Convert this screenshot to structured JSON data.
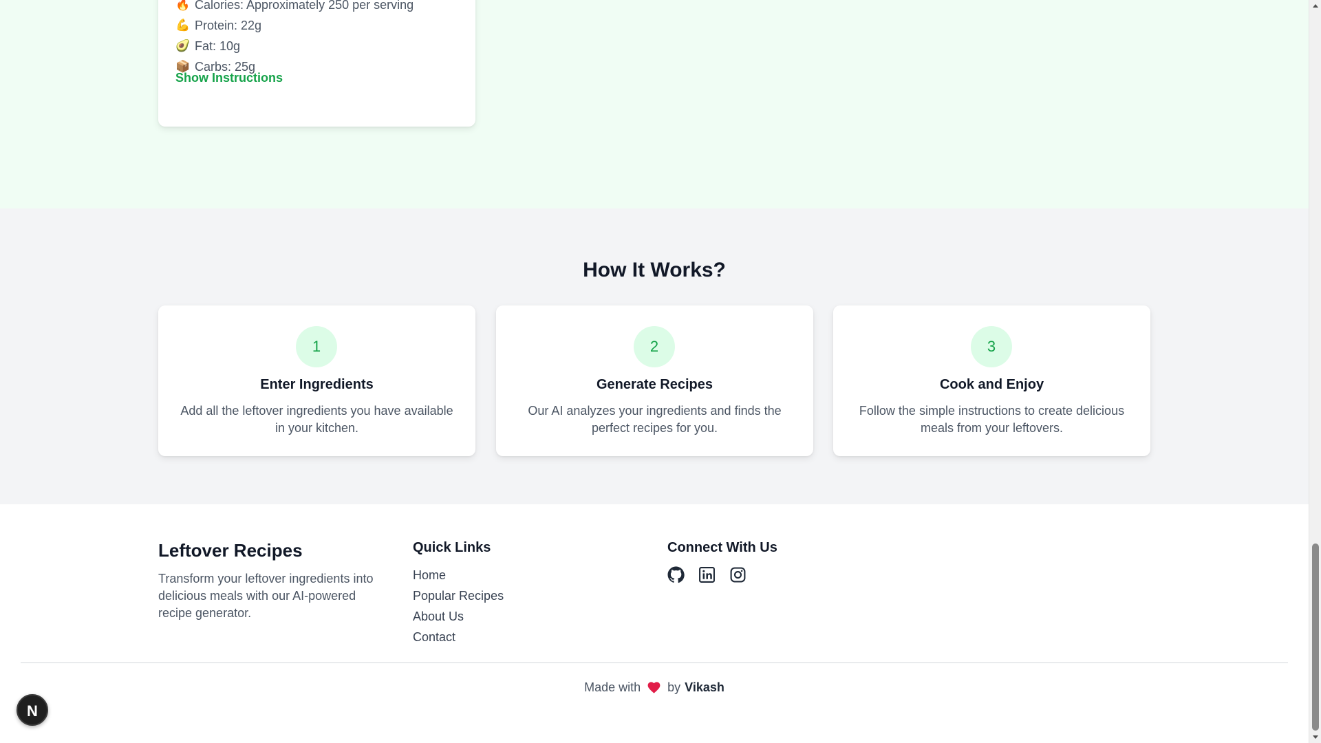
{
  "recipe_card": {
    "nutrition": [
      {
        "emoji": "🔥",
        "icon": "fire-icon",
        "text": "Calories: Approximately 250 per serving"
      },
      {
        "emoji": "💪",
        "icon": "flexed-biceps-icon",
        "text": "Protein: 22g"
      },
      {
        "emoji": "🥑",
        "icon": "avocado-icon",
        "text": "Fat: 10g"
      },
      {
        "emoji": "📦",
        "icon": "package-icon",
        "text": "Carbs: 25g"
      }
    ],
    "show_instructions_label": "Show Instructions"
  },
  "how_it_works": {
    "title": "How It Works?",
    "steps": [
      {
        "number": "1",
        "title": "Enter Ingredients",
        "description": "Add all the leftover ingredients you have available in your kitchen."
      },
      {
        "number": "2",
        "title": "Generate Recipes",
        "description": "Our AI analyzes your ingredients and finds the perfect recipes for you."
      },
      {
        "number": "3",
        "title": "Cook and Enjoy",
        "description": "Follow the simple instructions to create delicious meals from your leftovers."
      }
    ]
  },
  "footer": {
    "brand_title": "Leftover Recipes",
    "brand_description": "Transform your leftover ingredients into delicious meals with our AI-powered recipe generator.",
    "quick_links_title": "Quick Links",
    "quick_links": [
      "Home",
      "Popular Recipes",
      "About Us",
      "Contact"
    ],
    "connect_title": "Connect With Us",
    "social_icons": [
      "github-icon",
      "linkedin-icon",
      "instagram-icon"
    ],
    "credit_prefix": "Made with",
    "credit_middle": "by",
    "credit_author": "Vikash"
  },
  "badge": {
    "letter": "N"
  },
  "colors": {
    "accent_green": "#16a34a",
    "light_green_bg": "#f0fdf4",
    "step_circle_bg": "#dcfce7",
    "section_gray": "#f3f4f6",
    "heart": "#e11d48"
  }
}
